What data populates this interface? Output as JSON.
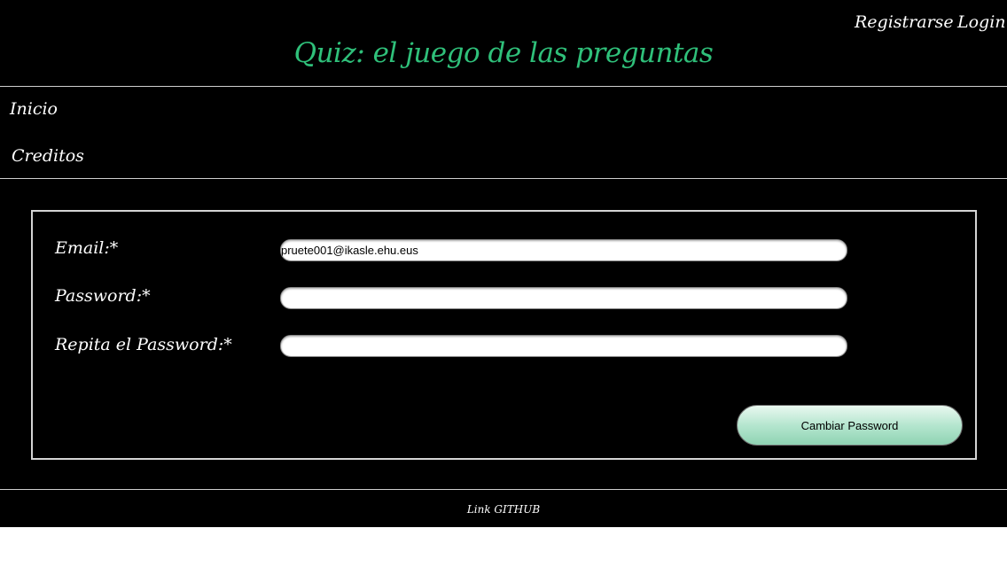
{
  "header": {
    "register_label": "Registrarse",
    "login_label": "Login",
    "title": "Quiz: el juego de las preguntas"
  },
  "nav": {
    "items": [
      {
        "label": "Inicio"
      },
      {
        "label": "Creditos"
      }
    ]
  },
  "form": {
    "email_label": "Email:*",
    "email_value": "pruete001@ikasle.ehu.eus",
    "password_label": "Password:*",
    "password_value": "",
    "repeat_label": "Repita el Password:*",
    "repeat_value": "",
    "submit_label": "Cambiar Password"
  },
  "footer": {
    "link_label": "Link GITHUB"
  },
  "colors": {
    "background": "#000000",
    "title": "#2fc07a",
    "text": "#ffffff",
    "button_gradient_top": "#e9f8f0",
    "button_gradient_bottom": "#8fd3b3"
  }
}
